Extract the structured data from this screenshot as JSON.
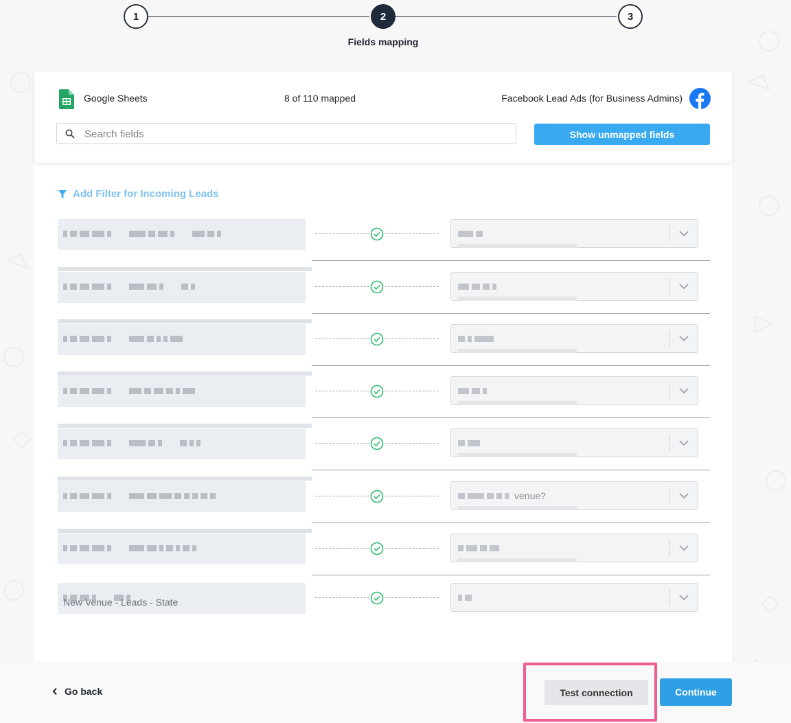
{
  "stepper": {
    "steps": [
      {
        "number": "1"
      },
      {
        "number": "2"
      },
      {
        "number": "3"
      }
    ],
    "active_label": "Fields mapping"
  },
  "header": {
    "source_app": "Google Sheets",
    "mapped_count": "8 of 110 mapped",
    "destination_app": "Facebook Lead Ads (for Business Admins)",
    "search_placeholder": "Search fields",
    "unmapped_button": "Show unmapped fields"
  },
  "filter": {
    "label": "Add Filter for Incoming Leads"
  },
  "rows": [
    {
      "source_text": "",
      "dest_text": ""
    },
    {
      "source_text": "",
      "dest_text": ""
    },
    {
      "source_text": "",
      "dest_text": ""
    },
    {
      "source_text": "",
      "dest_text": ""
    },
    {
      "source_text": "",
      "dest_text": ""
    },
    {
      "source_text": "",
      "dest_text": "venue?"
    },
    {
      "source_text": "",
      "dest_text": ""
    },
    {
      "source_text": "New Venue - Leads - State",
      "dest_text": ""
    }
  ],
  "footer": {
    "back_label": "Go back",
    "test_label": "Test connection",
    "continue_label": "Continue"
  },
  "colors": {
    "accent_blue": "#3aaaf0",
    "highlight_pink": "#ef5d92",
    "check_green": "#2ebd6b",
    "dark_navy": "#1f2a3a"
  },
  "icons": [
    "google-sheets-icon",
    "facebook-icon",
    "search-icon",
    "filter-icon",
    "check-circle-icon",
    "chevron-down-icon",
    "chevron-left-icon"
  ]
}
